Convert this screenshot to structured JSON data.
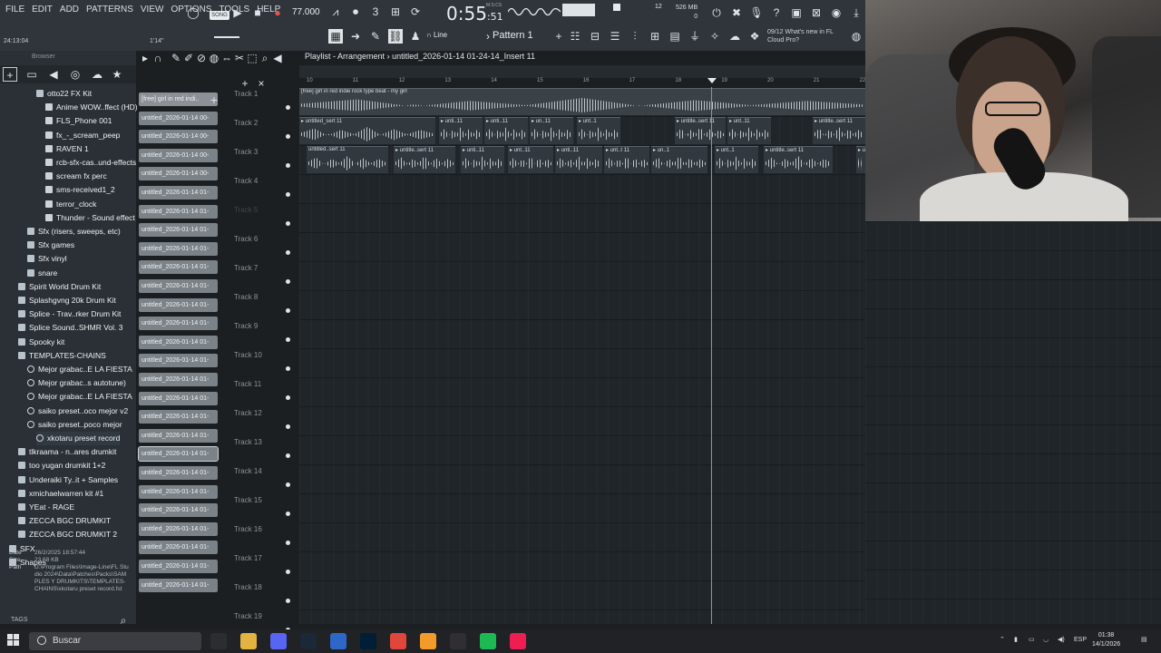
{
  "menu": [
    "FILE",
    "EDIT",
    "ADD",
    "PATTERNS",
    "VIEW",
    "OPTIONS",
    "TOOLS",
    "HELP"
  ],
  "transport": {
    "song_label": "SONG",
    "tempo": "77.000",
    "time_main": "0:55",
    "time_sub": ":51",
    "time_units": "M:S:CS",
    "cpu_num": "12",
    "ram": "526 MB",
    "poly": "0"
  },
  "hint": {
    "left": "24:13:04",
    "right": "1'14\""
  },
  "news": {
    "date": "09/12",
    "text1": "What's new in FL",
    "text2": "Cloud Pro?"
  },
  "toolbar": {
    "line_mode": "Line",
    "pattern": "Pattern 1"
  },
  "browser": {
    "header": "Browser",
    "items": [
      {
        "label": "otto22 FX Kit",
        "kind": "folder",
        "indent": 3
      },
      {
        "label": "Anime WOW..ffect (HD)",
        "kind": "file",
        "indent": 4
      },
      {
        "label": "FLS_Phone 001",
        "kind": "file",
        "indent": 4
      },
      {
        "label": "fx_-_scream_peep",
        "kind": "file",
        "indent": 4
      },
      {
        "label": "RAVEN 1",
        "kind": "file",
        "indent": 4
      },
      {
        "label": "rcb-sfx-cas..und-effects",
        "kind": "file",
        "indent": 4
      },
      {
        "label": "scream fx perc",
        "kind": "file",
        "indent": 4
      },
      {
        "label": "sms-received1_2",
        "kind": "file",
        "indent": 4
      },
      {
        "label": "terror_clock",
        "kind": "file",
        "indent": 4
      },
      {
        "label": "Thunder - Sound effect",
        "kind": "file",
        "indent": 4
      },
      {
        "label": "Sfx (risers, sweeps, etc)",
        "kind": "folder",
        "indent": 2
      },
      {
        "label": "Sfx games",
        "kind": "folder",
        "indent": 2
      },
      {
        "label": "Sfx vinyl",
        "kind": "folder",
        "indent": 2
      },
      {
        "label": "snare",
        "kind": "folder",
        "indent": 2
      },
      {
        "label": "Spirit World Drum Kit",
        "kind": "folder",
        "indent": 1
      },
      {
        "label": "Splashgvng 20k Drum Kit",
        "kind": "folder",
        "indent": 1
      },
      {
        "label": "Splice - Trav..rker Drum Kit",
        "kind": "folder",
        "indent": 1
      },
      {
        "label": "Splice Sound..SHMR Vol. 3",
        "kind": "folder",
        "indent": 1
      },
      {
        "label": "Spooky kit",
        "kind": "folder",
        "indent": 1
      },
      {
        "label": "TEMPLATES-CHAINS",
        "kind": "folder",
        "indent": 1
      },
      {
        "label": "Mejor grabac..E LA FIESTA",
        "kind": "gear",
        "indent": 2
      },
      {
        "label": "Mejor grabac..s autotune)",
        "kind": "gear",
        "indent": 2
      },
      {
        "label": "Mejor grabac..E LA FIESTA",
        "kind": "gear",
        "indent": 2
      },
      {
        "label": "saiko preset..oco mejor v2",
        "kind": "gear",
        "indent": 2
      },
      {
        "label": "saiko preset..poco mejor",
        "kind": "gear",
        "indent": 2
      },
      {
        "label": "xkotaru preset record",
        "kind": "gear",
        "indent": 3
      },
      {
        "label": "tlkraama - n..ares drumkit",
        "kind": "folder",
        "indent": 1
      },
      {
        "label": "too yugan drumkit 1+2",
        "kind": "folder",
        "indent": 1
      },
      {
        "label": "Underaiki Ty..it + Samples",
        "kind": "folder",
        "indent": 1
      },
      {
        "label": "xmichaelwarren kit #1",
        "kind": "folder",
        "indent": 1
      },
      {
        "label": "YEat - RAGE",
        "kind": "folder",
        "indent": 1
      },
      {
        "label": "ZECCA BGC DRUMKIT",
        "kind": "folder",
        "indent": 1
      },
      {
        "label": "ZECCA BGC DRUMKIT 2",
        "kind": "folder",
        "indent": 1
      },
      {
        "label": "SFX",
        "kind": "folder",
        "indent": 0
      },
      {
        "label": "Shapes",
        "kind": "folder",
        "indent": 0
      }
    ],
    "info": {
      "date_label": "Date",
      "date": "26/2/2025 18:57:44",
      "size_label": "Size",
      "size": "23.68 KB",
      "path_label": "Path",
      "path": "D:\\Program Files\\Image-Line\\FL Studio 2024\\Data\\Patches\\Packs\\SAMPLES Y DRUMKITS\\TEMPLATES-CHAINS\\xkotaru preset record.fst"
    },
    "tags": "TAGS"
  },
  "picker": {
    "items": [
      "[free] girl in red indi..",
      "untitled_2026-01-14 00-",
      "untitled_2026-01-14 00-",
      "untitled_2026-01-14 00-",
      "untitled_2026-01-14 00-",
      "untitled_2026-01-14 01-",
      "untitled_2026-01-14 01-",
      "untitled_2026-01-14 01-",
      "untitled_2026-01-14 01-",
      "untitled_2026-01-14 01-",
      "untitled_2026-01-14 01-",
      "untitled_2026-01-14 01-",
      "untitled_2026-01-14 01-",
      "untitled_2026-01-14 01-",
      "untitled_2026-01-14 01-",
      "untitled_2026-01-14 01-",
      "untitled_2026-01-14 01-",
      "untitled_2026-01-14 01-",
      "untitled_2026-01-14 01-",
      "untitled_2026-01-14 01-",
      "untitled_2026-01-14 01-",
      "untitled_2026-01-14 01-",
      "untitled_2026-01-14 01-",
      "untitled_2026-01-14 01-",
      "untitled_2026-01-14 01-",
      "untitled_2026-01-14 01-",
      "untitled_2026-01-14 01-"
    ],
    "selected_index": 19
  },
  "playlist": {
    "title": "Playlist - Arrangement",
    "arrangement": "untitled_2026-01-14 01-24-14_Insert 11",
    "ruler": [
      "10",
      "11",
      "12",
      "13",
      "14",
      "15",
      "16",
      "17",
      "18",
      "19",
      "20",
      "21",
      "22"
    ],
    "tracks": [
      "Track 1",
      "Track 2",
      "Track 3",
      "Track 4",
      "Track 5",
      "Track 6",
      "Track 7",
      "Track 8",
      "Track 9",
      "Track 10",
      "Track 11",
      "Track 12",
      "Track 13",
      "Track 14",
      "Track 15",
      "Track 16",
      "Track 17",
      "Track 18",
      "Track 19"
    ],
    "track1_clip": "[free] girl in red  indie rock type beat - my girl",
    "track2_clips": [
      "▸ untitled_sert 11",
      "▸ unti..11",
      "▸ unti..11",
      "▸ un..11",
      "▸ unt..1",
      "▸ untitle..sert 11",
      "▸ unt..11",
      "▸ untitle..sert 11"
    ],
    "track3_clips": [
      "untitled..sert 11",
      "▸ untitle..sert 11",
      "▸ unti..11",
      "▸ unt..11",
      "▸ unti..11",
      "▸ unt..t 11",
      "▸ un..1",
      "▸ unt..1",
      "▸ untitle..sert 11",
      "▸ un.."
    ]
  },
  "taskbar": {
    "search_placeholder": "Buscar",
    "lang": "ESP",
    "time": "01:38",
    "date": "14/1/2026",
    "apps": [
      {
        "name": "ide-icon",
        "color": "#2b2d31"
      },
      {
        "name": "file-explorer-icon",
        "color": "#e3b341"
      },
      {
        "name": "discord-icon",
        "color": "#5865f2"
      },
      {
        "name": "steam-icon",
        "color": "#1b2838"
      },
      {
        "name": "visual-app-icon",
        "color": "#2f67c9"
      },
      {
        "name": "photoshop-icon",
        "color": "#001e36"
      },
      {
        "name": "chrome-icon",
        "color": "#e0463a"
      },
      {
        "name": "fl-studio-icon",
        "color": "#f29b2b"
      },
      {
        "name": "obs-icon",
        "color": "#302e31"
      },
      {
        "name": "spotify-icon",
        "color": "#1db954"
      },
      {
        "name": "tiktok-icon",
        "color": "#ee1d52"
      }
    ]
  }
}
